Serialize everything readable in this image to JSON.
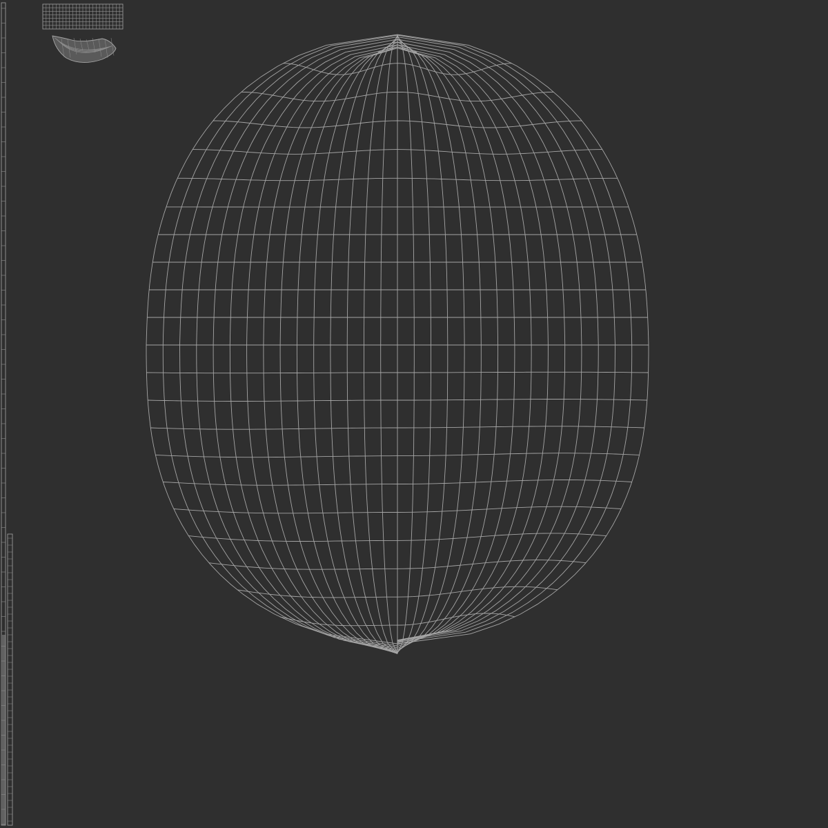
{
  "colors": {
    "background": "#2f2f2f",
    "wire": "#a6a6a6",
    "wire_dim": "#8f8f8f",
    "strip_fill": "#8a8a8a"
  }
}
